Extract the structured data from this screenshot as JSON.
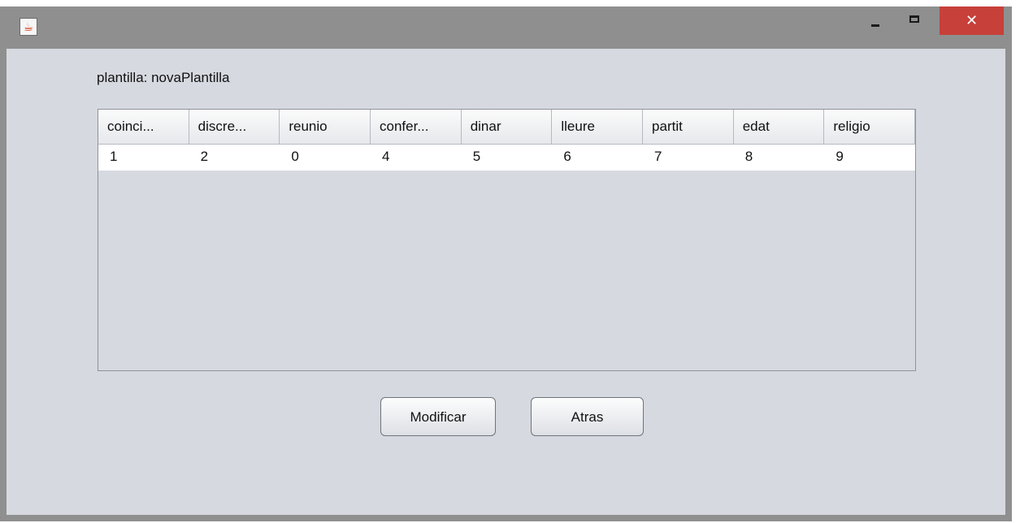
{
  "window": {
    "app_icon": "java-icon"
  },
  "titlebar_controls": {
    "close_glyph": "✕"
  },
  "template": {
    "label": "plantilla: novaPlantilla"
  },
  "table": {
    "columns": [
      "coinci...",
      "discre...",
      "reunio",
      "confer...",
      "dinar",
      "lleure",
      "partit",
      "edat",
      "religio"
    ],
    "rows": [
      [
        "1",
        "2",
        "0",
        "4",
        "5",
        "6",
        "7",
        "8",
        "9"
      ]
    ]
  },
  "buttons": {
    "modify_label": "Modificar",
    "back_label": "Atras"
  },
  "colors": {
    "panel_bg": "#d6d9df",
    "close_button": "#c7403a",
    "titlebar": "#8f8f8f"
  }
}
